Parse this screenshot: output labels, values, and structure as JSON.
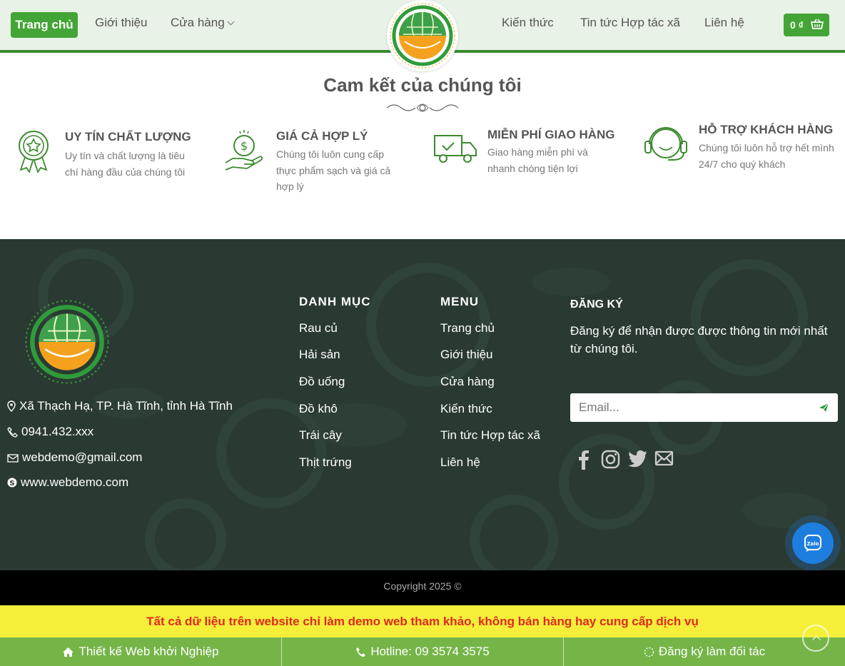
{
  "nav": {
    "home": "Trang chủ",
    "about": "Giới thiệu",
    "shop": "Cửa hàng",
    "knowledge": "Kiến thức",
    "news": "Tin tức Hợp tác xã",
    "contact": "Liên hệ",
    "cart": "0 ₫"
  },
  "commitment": {
    "title": "Cam kết của chúng tôi",
    "items": [
      {
        "title": "UY TÍN CHẤT LƯỢNG",
        "desc": "Uy tín và chất lượng là tiêu chí hàng đầu của chúng tôi",
        "icon": "medal-star-icon"
      },
      {
        "title": "GIÁ CẢ HỢP LÝ",
        "desc": "Chúng tôi luôn cung cấp thực phẩm sạch và giá cả hợp lý",
        "icon": "hand-money-icon"
      },
      {
        "title": "MIỄN PHÍ GIAO HÀNG",
        "desc": "Giao hàng miễn phí và nhanh chóng tiện lợi",
        "icon": "truck-icon"
      },
      {
        "title": "HỖ TRỢ KHÁCH HÀNG",
        "desc": "Chúng tôi luôn hỗ trợ hết mình 24/7 cho quý khách",
        "icon": "headset-icon"
      }
    ]
  },
  "footer": {
    "contact": {
      "address": "Xã Thạch Hạ, TP. Hà Tĩnh, tỉnh Hà Tĩnh",
      "phone": "0941.432.xxx",
      "email": "webdemo@gmail.com",
      "website": "www.webdemo.com"
    },
    "categories": {
      "heading": "DANH MỤC",
      "items": [
        "Rau củ",
        "Hải sản",
        "Đồ uống",
        "Đồ khô",
        "Trái cây",
        "Thịt trứng"
      ]
    },
    "menu": {
      "heading": "MENU",
      "items": [
        "Trang chủ",
        "Giới thiệu",
        "Cửa hàng",
        "Kiến thức",
        "Tin tức Hợp tác xã",
        "Liên hệ"
      ]
    },
    "subscribe": {
      "heading": "ĐĂNG KÝ",
      "text": "Đăng ký để nhận được được thông tin mới nhất từ chúng tôi.",
      "placeholder": "Email..."
    }
  },
  "copyright": "Copyright 2025 ©",
  "notice": "Tất cả dữ liệu trên website chỉ làm demo web tham khảo, không bán hàng hay cung cấp dịch vụ",
  "bottom_bar": {
    "design": "Thiết kế Web khởi Nghiệp",
    "hotline": "Hotline: 09 3574 3575",
    "partner": "Đăng ký làm đối tác"
  },
  "colors": {
    "primary": "#43a535",
    "footer_bg": "#2a3a33",
    "notice_bg": "#f6ef3a",
    "notice_text": "#e0291b",
    "bottom_bar": "#75b548"
  }
}
